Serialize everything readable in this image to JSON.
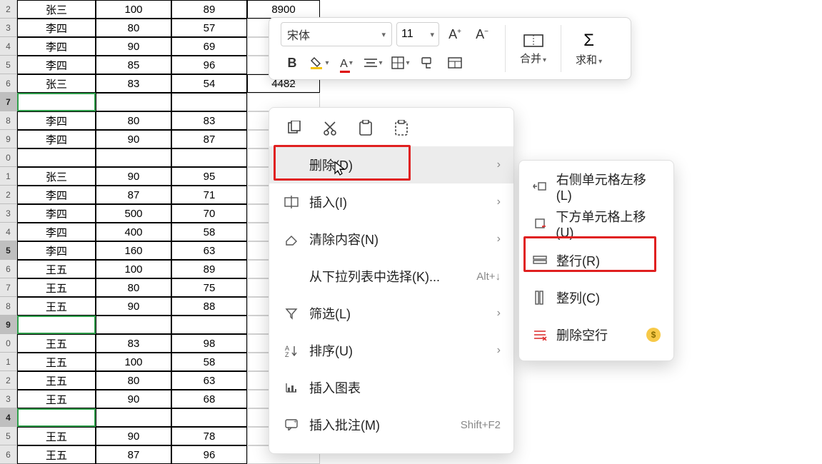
{
  "toolbar": {
    "font_name": "宋体",
    "font_size": "11",
    "merge_label": "合并",
    "sum_label": "求和",
    "bold": "B",
    "inc_font_icon": "A+",
    "dec_font_icon": "A−"
  },
  "row_headers": [
    "2",
    "3",
    "4",
    "5",
    "6",
    "7",
    "8",
    "9",
    "0",
    "1",
    "2",
    "3",
    "4",
    "5",
    "6",
    "7",
    "8",
    "9",
    "0",
    "1",
    "2",
    "3",
    "4",
    "5",
    "6"
  ],
  "selected_rows": [
    5,
    13,
    17,
    22
  ],
  "table": {
    "rows": [
      {
        "a": "张三",
        "b": "100",
        "c": "89",
        "d": "8900"
      },
      {
        "a": "李四",
        "b": "80",
        "c": "57",
        "d": ""
      },
      {
        "a": "李四",
        "b": "90",
        "c": "69",
        "d": ""
      },
      {
        "a": "李四",
        "b": "85",
        "c": "96",
        "d": ""
      },
      {
        "a": "张三",
        "b": "83",
        "c": "54",
        "d": "4482"
      },
      {
        "a": "",
        "b": "",
        "c": "",
        "d": ""
      },
      {
        "a": "李四",
        "b": "80",
        "c": "83",
        "d": ""
      },
      {
        "a": "李四",
        "b": "90",
        "c": "87",
        "d": ""
      },
      {
        "a": "",
        "b": "",
        "c": "",
        "d": ""
      },
      {
        "a": "张三",
        "b": "90",
        "c": "95",
        "d": ""
      },
      {
        "a": "李四",
        "b": "87",
        "c": "71",
        "d": ""
      },
      {
        "a": "李四",
        "b": "500",
        "c": "70",
        "d": ""
      },
      {
        "a": "李四",
        "b": "400",
        "c": "58",
        "d": ""
      },
      {
        "a": "李四",
        "b": "160",
        "c": "63",
        "d": ""
      },
      {
        "a": "王五",
        "b": "100",
        "c": "89",
        "d": ""
      },
      {
        "a": "王五",
        "b": "80",
        "c": "75",
        "d": ""
      },
      {
        "a": "王五",
        "b": "90",
        "c": "88",
        "d": ""
      },
      {
        "a": "",
        "b": "",
        "c": "",
        "d": ""
      },
      {
        "a": "王五",
        "b": "83",
        "c": "98",
        "d": ""
      },
      {
        "a": "王五",
        "b": "100",
        "c": "58",
        "d": ""
      },
      {
        "a": "王五",
        "b": "80",
        "c": "63",
        "d": ""
      },
      {
        "a": "王五",
        "b": "90",
        "c": "68",
        "d": ""
      },
      {
        "a": "",
        "b": "",
        "c": "",
        "d": ""
      },
      {
        "a": "王五",
        "b": "90",
        "c": "78",
        "d": ""
      },
      {
        "a": "王五",
        "b": "87",
        "c": "96",
        "d": ""
      }
    ]
  },
  "context_menu": {
    "delete": "删除(D)",
    "insert": "插入(I)",
    "clear": "清除内容(N)",
    "dropdown_select": "从下拉列表中选择(K)...",
    "dropdown_hint": "Alt+↓",
    "filter": "筛选(L)",
    "sort": "排序(U)",
    "insert_chart": "插入图表",
    "insert_comment": "插入批注(M)",
    "comment_hint": "Shift+F2"
  },
  "submenu": {
    "shift_left": "右侧单元格左移(L)",
    "shift_up": "下方单元格上移(U)",
    "entire_row": "整行(R)",
    "entire_col": "整列(C)",
    "delete_blank": "删除空行"
  },
  "colors": {
    "highlight_red": "#e02020",
    "selection_green": "#2e9e4a"
  }
}
